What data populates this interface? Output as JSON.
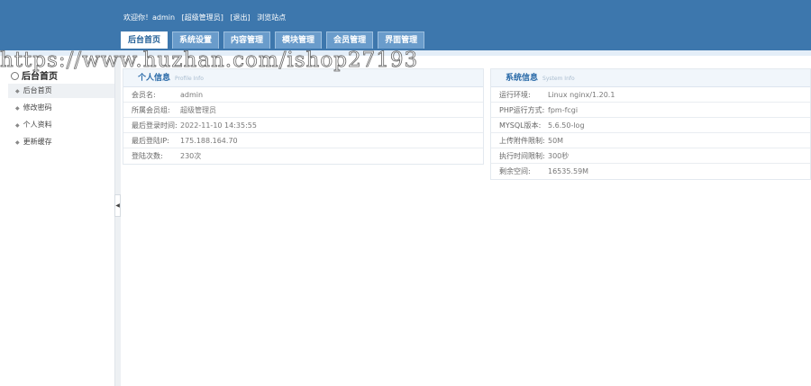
{
  "topbar": {
    "welcome": "欢迎你！admin",
    "role": "[超级管理员]",
    "logout": "[退出]",
    "visit_site": "浏览站点"
  },
  "nav": {
    "tabs": [
      "后台首页",
      "系统设置",
      "内容管理",
      "模块管理",
      "会员管理",
      "界面管理"
    ]
  },
  "sidebar": {
    "title": "后台首页",
    "items": [
      "后台首页",
      "修改密码",
      "个人资料",
      "更新缓存"
    ]
  },
  "personal": {
    "title": "个人信息",
    "subtitle": "Profile Info",
    "rows": [
      {
        "label": "会员名:",
        "value": "admin"
      },
      {
        "label": "所属会员组:",
        "value": "超级管理员"
      },
      {
        "label": "最后登录时间:",
        "value": "2022-11-10 14:35:55"
      },
      {
        "label": "最后登陆IP:",
        "value": "175.188.164.70"
      },
      {
        "label": "登陆次数:",
        "value": "230次"
      }
    ]
  },
  "system": {
    "title": "系统信息",
    "subtitle": "System Info",
    "rows": [
      {
        "label": "运行环境:",
        "value": "Linux nginx/1.20.1"
      },
      {
        "label": "PHP运行方式:",
        "value": "fpm-fcgi"
      },
      {
        "label": "MYSQL版本:",
        "value": "5.6.50-log"
      },
      {
        "label": "上传附件限制:",
        "value": "50M"
      },
      {
        "label": "执行时间限制:",
        "value": "300秒"
      },
      {
        "label": "剩余空间:",
        "value": "16535.59M"
      }
    ]
  },
  "watermark": "https://www.huzhan.com/ishop27193"
}
